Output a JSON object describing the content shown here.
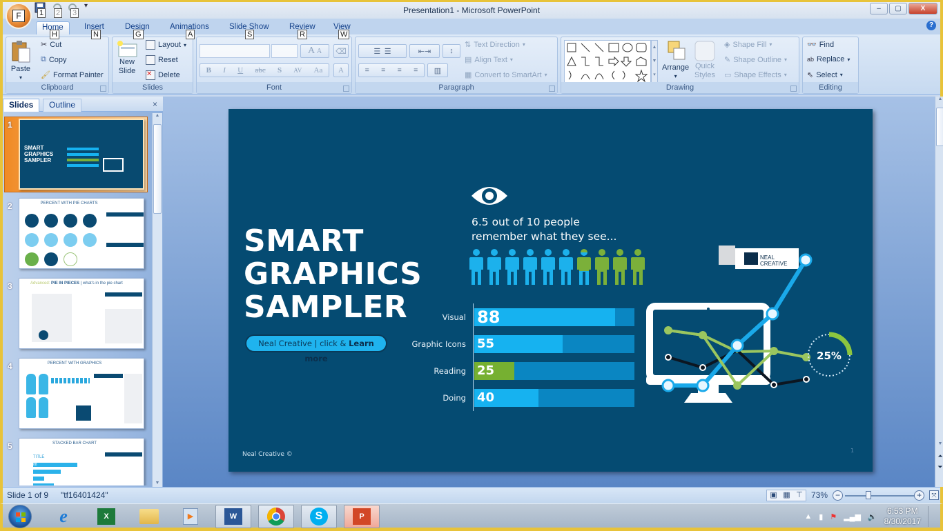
{
  "window": {
    "title": "Presentation1 - Microsoft PowerPoint",
    "office_button_keytip": "F",
    "quick_access_keytips": [
      "1",
      "2",
      "3"
    ],
    "controls": {
      "minimize": "–",
      "maximize": "▢",
      "close": "X"
    }
  },
  "tabs": [
    {
      "label": "Home",
      "keytip": "H",
      "active": true
    },
    {
      "label": "Insert",
      "keytip": "N"
    },
    {
      "label": "Design",
      "keytip": "G"
    },
    {
      "label": "Animations",
      "keytip": "A"
    },
    {
      "label": "Slide Show",
      "keytip": "S"
    },
    {
      "label": "Review",
      "keytip": "R"
    },
    {
      "label": "View",
      "keytip": "W"
    }
  ],
  "ribbon": {
    "clipboard": {
      "label": "Clipboard",
      "paste": "Paste",
      "cut": "Cut",
      "copy": "Copy",
      "format_painter": "Format Painter"
    },
    "slides": {
      "label": "Slides",
      "new_slide_1": "New",
      "new_slide_2": "Slide",
      "layout": "Layout",
      "reset": "Reset",
      "delete": "Delete"
    },
    "font": {
      "label": "Font",
      "bold": "B",
      "italic": "I",
      "underline": "U",
      "strike": "abc",
      "shadow": "S",
      "spacing": "AV",
      "case": "Aa",
      "color": "A",
      "grow": "A",
      "shrink": "A"
    },
    "paragraph": {
      "label": "Paragraph",
      "text_direction": "Text Direction",
      "align_text": "Align Text",
      "convert_smartart": "Convert to SmartArt"
    },
    "drawing": {
      "label": "Drawing",
      "arrange": "Arrange",
      "quick_styles_1": "Quick",
      "quick_styles_2": "Styles",
      "shape_fill": "Shape Fill",
      "shape_outline": "Shape Outline",
      "shape_effects": "Shape Effects"
    },
    "editing": {
      "label": "Editing",
      "find": "Find",
      "replace": "Replace",
      "select": "Select"
    }
  },
  "left_pane": {
    "tabs": [
      "Slides",
      "Outline"
    ],
    "close": "×",
    "thumbnails": [
      {
        "num": "1",
        "title": "SMART GRAPHICS SAMPLER",
        "selected": true
      },
      {
        "num": "2",
        "title": "PERCENT WITH PIE CHARTS"
      },
      {
        "num": "3",
        "title_prefix": "Advanced:",
        "title": "PIE IN PIECES",
        "title_suffix": "| what's in the pie chart"
      },
      {
        "num": "4",
        "title": "PERCENT WITH GRAPHICS"
      },
      {
        "num": "5",
        "title": "STACKED BAR CHART",
        "sub": "TITLE",
        "bar_value": "88"
      }
    ]
  },
  "slide": {
    "title_lines": [
      "SMART",
      "GRAPHICS",
      "SAMPLER"
    ],
    "cta": {
      "text": "Neal Creative  | click & ",
      "bold": "Learn more"
    },
    "tagline_1": "6.5 out of 10 people",
    "tagline_2": "remember what they see...",
    "people": {
      "total": 10,
      "blue_fraction": 6.5,
      "blue": "#1cb1ec",
      "green": "#7bb03a"
    },
    "bars": [
      {
        "label": "Visual",
        "value": 88,
        "color": "#16b2f0"
      },
      {
        "label": "Graphic Icons",
        "value": 55,
        "color": "#16b2f0"
      },
      {
        "label": "Reading",
        "value": 25,
        "color": "#76b031"
      },
      {
        "label": "Doing",
        "value": 40,
        "color": "#16b2f0"
      }
    ],
    "logo_text_1": "NEAL",
    "logo_text_2": "CREATIVE",
    "donut_value": "25%",
    "donut_fraction": 0.25,
    "footer": "Neal Creative ©",
    "page_number": "1",
    "colors": {
      "background": "#054b72",
      "accent_blue": "#16b2f0",
      "accent_green": "#7bb03a"
    }
  },
  "status": {
    "slide_info": "Slide 1 of 9",
    "theme": "\"tf16401424\"",
    "zoom": "73%",
    "zoom_minus": "−",
    "zoom_plus": "+"
  },
  "taskbar": {
    "apps": [
      "Internet Explorer",
      "Excel",
      "File Explorer",
      "Media Player",
      "Word",
      "Chrome",
      "Skype",
      "PowerPoint"
    ],
    "time": "6:53 PM",
    "date": "8/30/2017"
  }
}
